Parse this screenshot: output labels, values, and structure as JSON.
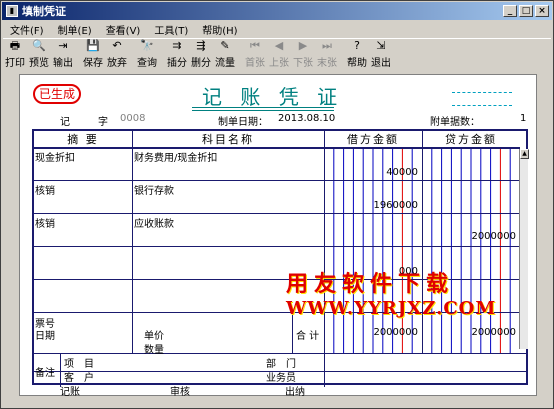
{
  "window": {
    "title": "填制凭证",
    "controls": [
      "_",
      "□",
      "×"
    ]
  },
  "menu": [
    "文件(F)",
    "制单(E)",
    "查看(V)",
    "工具(T)",
    "帮助(H)"
  ],
  "toolbar": [
    {
      "label": "打印",
      "icon": "🖶",
      "enabled": true
    },
    {
      "label": "预览",
      "icon": "🔍",
      "enabled": true
    },
    {
      "label": "输出",
      "icon": "⇥",
      "enabled": true
    },
    {
      "label": "保存",
      "icon": "💾",
      "enabled": true
    },
    {
      "label": "放弃",
      "icon": "↶",
      "enabled": true
    },
    {
      "label": "查询",
      "icon": "🔭",
      "enabled": true
    },
    {
      "label": "插分",
      "icon": "⇉",
      "enabled": true
    },
    {
      "label": "删分",
      "icon": "⇶",
      "enabled": true
    },
    {
      "label": "流量",
      "icon": "✎",
      "enabled": true
    },
    {
      "label": "首张",
      "icon": "⏮",
      "enabled": false
    },
    {
      "label": "上张",
      "icon": "◀",
      "enabled": false
    },
    {
      "label": "下张",
      "icon": "▶",
      "enabled": false
    },
    {
      "label": "末张",
      "icon": "⏭",
      "enabled": false
    },
    {
      "label": "帮助",
      "icon": "?",
      "enabled": true
    },
    {
      "label": "退出",
      "icon": "⇲",
      "enabled": true
    }
  ],
  "voucher": {
    "status": "已生成",
    "title": "记 账 凭 证",
    "type_label": "记",
    "number_label": "字",
    "number": "0008",
    "date_label": "制单日期：",
    "date": "2013.08.10",
    "attach_label": "附单据数：",
    "attach": "1",
    "headers": [
      "摘 要",
      "科目名称",
      "借方金额",
      "贷方金额"
    ],
    "rows": [
      {
        "summary": "现金折扣",
        "account": "财务费用/现金折扣",
        "debit": "40000",
        "credit": ""
      },
      {
        "summary": "核销",
        "account": "银行存款",
        "debit": "1960000",
        "credit": ""
      },
      {
        "summary": "核销",
        "account": "应收账款",
        "debit": "",
        "credit": "2000000"
      },
      {
        "summary": "",
        "account": "",
        "debit": "000",
        "credit": ""
      },
      {
        "summary": "",
        "account": "",
        "debit": "",
        "credit": ""
      }
    ],
    "ticket_label": "票号",
    "date_field_label": "日期",
    "price_label": "单价",
    "qty_label": "数量",
    "total_label": "合 计",
    "total_debit": "2000000",
    "total_credit": "2000000",
    "memo_label": "备注",
    "project_label": "项　目",
    "customer_label": "客　户",
    "dept_label": "部　门",
    "salesman_label": "业务员",
    "footer": [
      "记账",
      "审核",
      "出纳"
    ]
  },
  "watermark": {
    "text": "用友软件下载",
    "url": "WWW.YYRJXZ.COM"
  },
  "colors": {
    "title": "#008080",
    "stamp": "#e00000",
    "grid": "#1a1a6e",
    "blue_line": "#0000c0",
    "red_line": "#e00000"
  }
}
